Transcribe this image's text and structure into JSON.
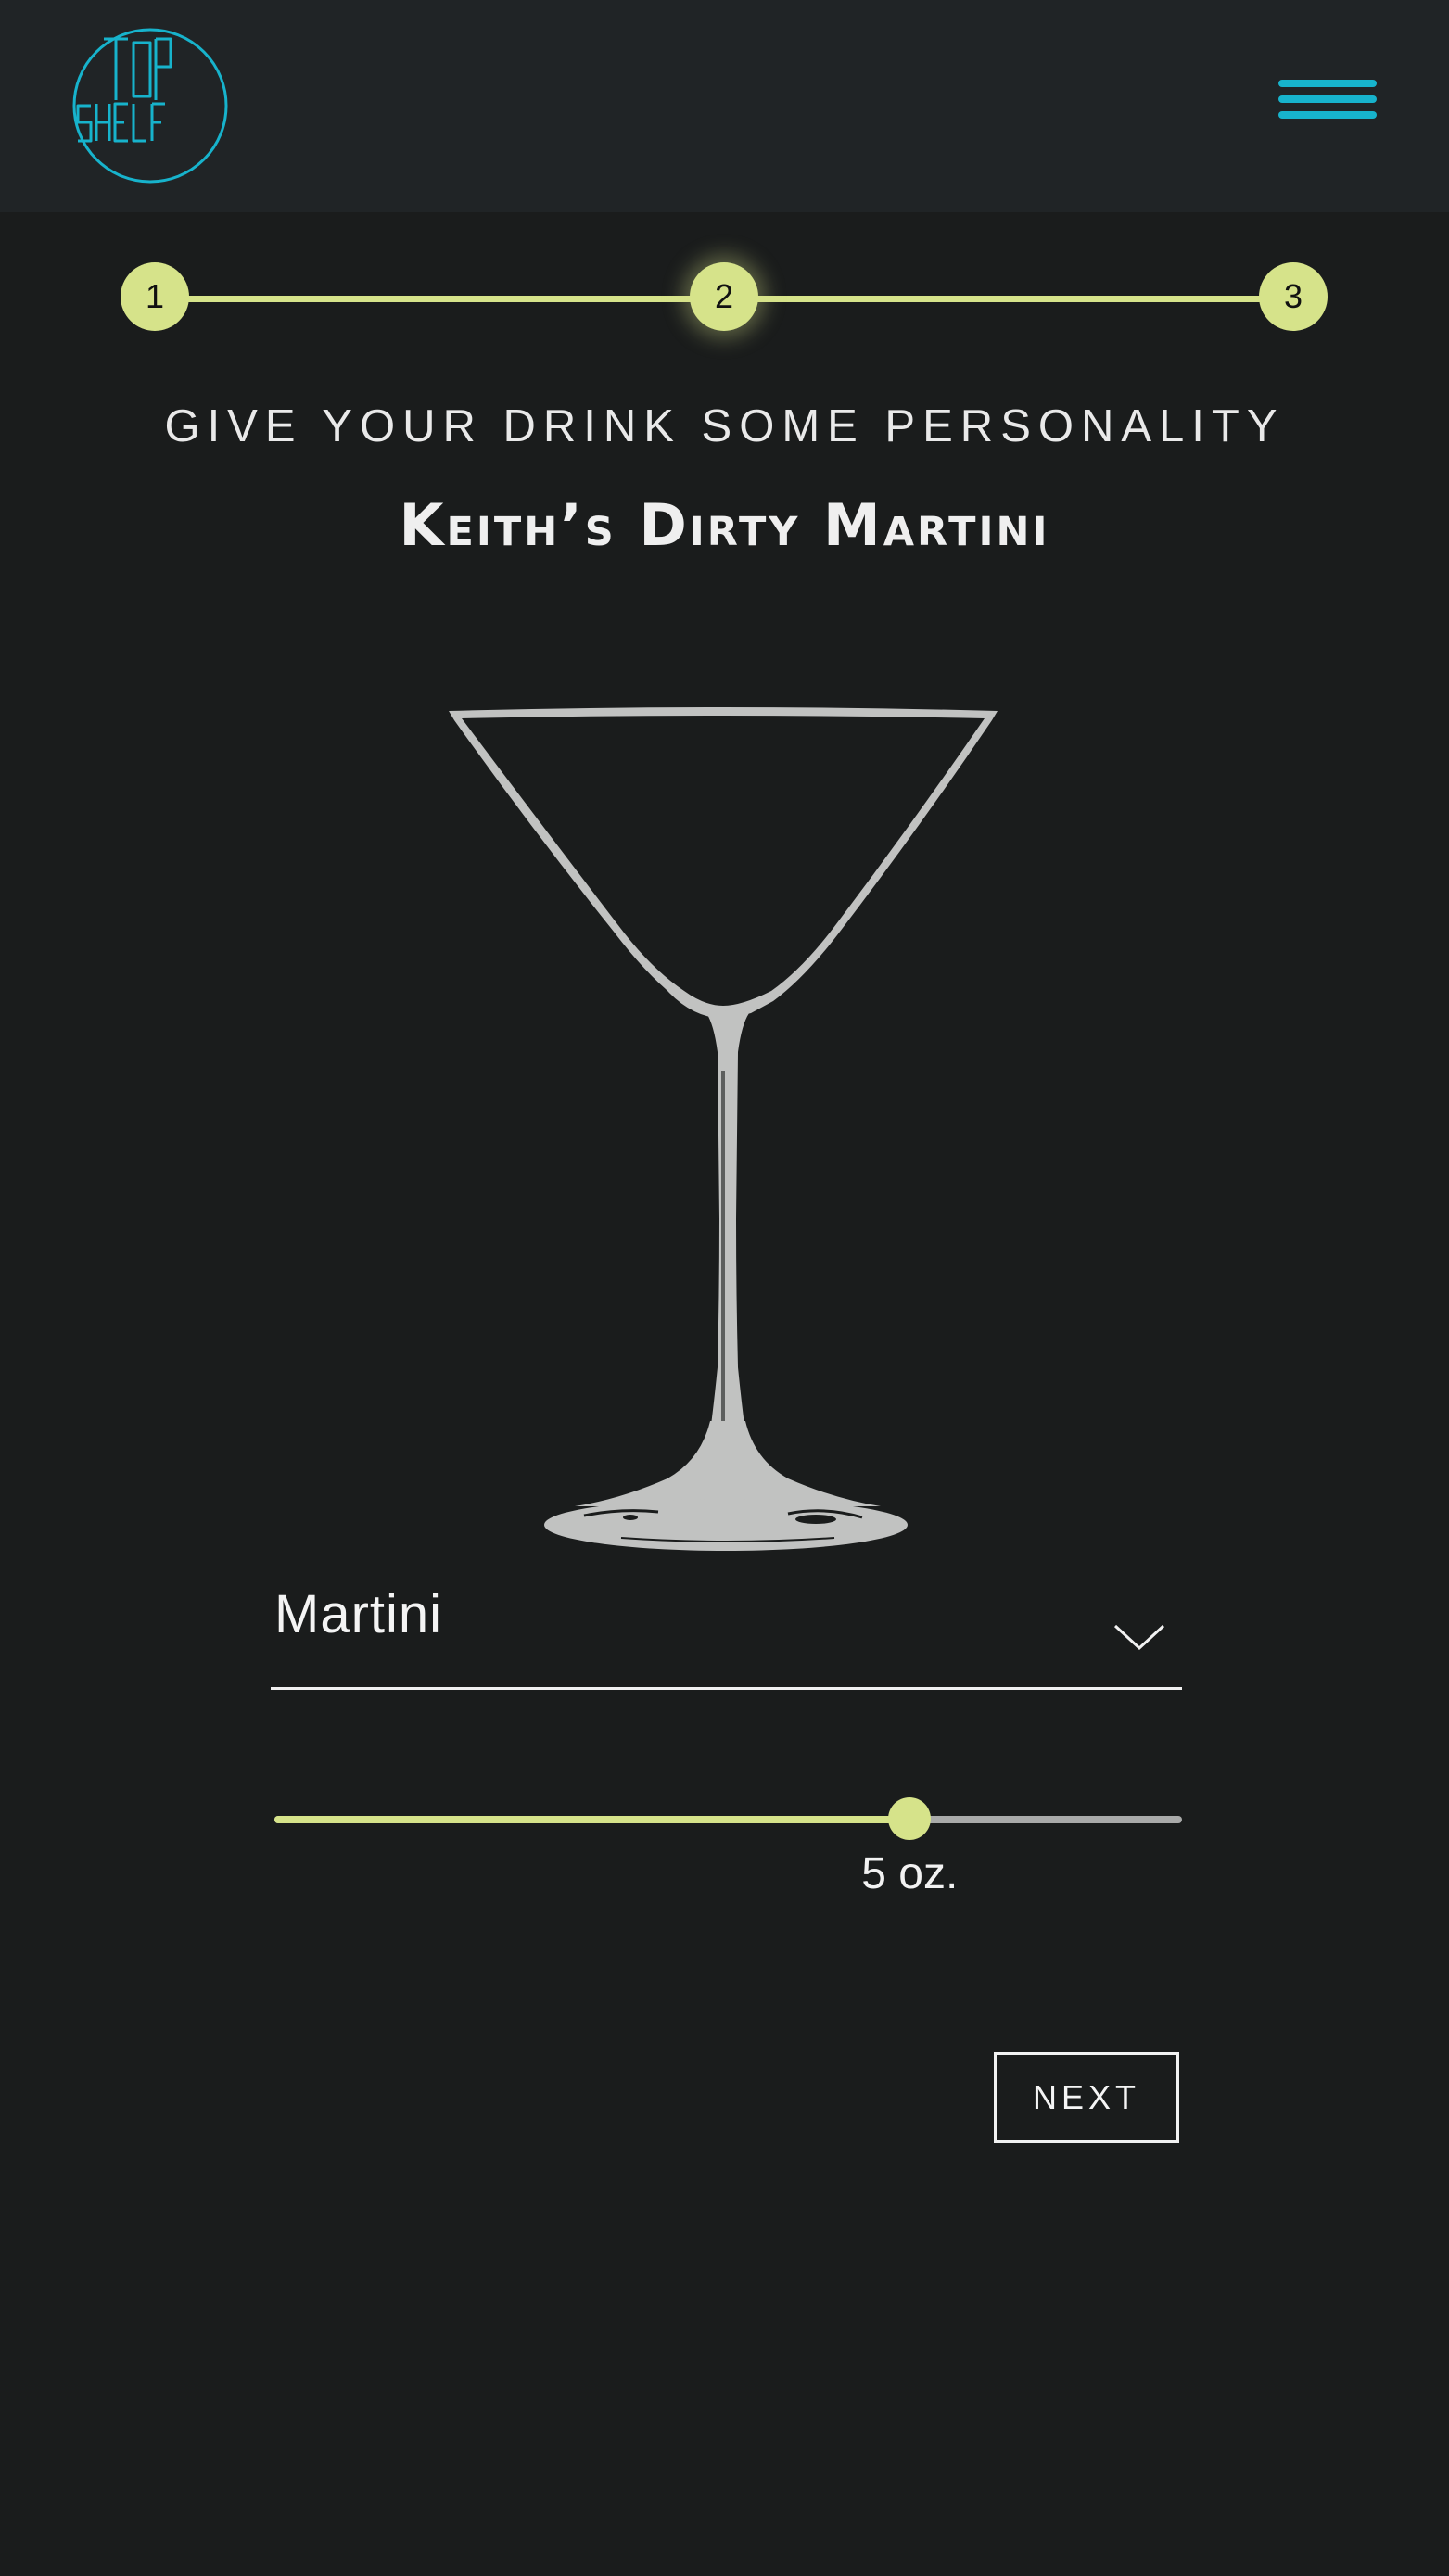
{
  "brand": {
    "logo_text": "TOP SHELF"
  },
  "header": {
    "menu_icon": "hamburger-menu-icon"
  },
  "stepper": {
    "steps": [
      "1",
      "2",
      "3"
    ],
    "current_step": 2
  },
  "content": {
    "subtitle": "GIVE YOUR DRINK SOME PERSONALITY",
    "drink_name": "Keith’s Dirty Martini"
  },
  "glass_select": {
    "value": "Martini",
    "icon": "chevron-down-icon"
  },
  "volume_slider": {
    "fraction": 0.7,
    "label": "5 oz."
  },
  "actions": {
    "next_label": "NEXT"
  },
  "colors": {
    "accent": "#d6e38a",
    "logo": "#17b3cc",
    "background": "#1a1c1c",
    "header": "#202426"
  }
}
